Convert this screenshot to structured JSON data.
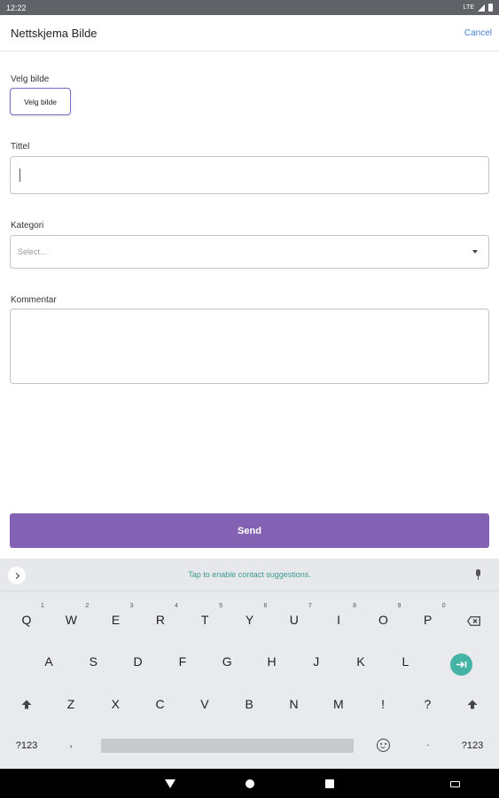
{
  "status_bar": {
    "time": "12:22",
    "network": "LTE"
  },
  "app_bar": {
    "title": "Nettskjema Bilde",
    "cancel": "Cancel"
  },
  "form": {
    "image_label": "Velg bilde",
    "image_button": "Velg bilde",
    "title_label": "Tittel",
    "title_value": "",
    "category_label": "Kategori",
    "category_placeholder": "Select...",
    "comment_label": "Kommentar",
    "comment_value": "",
    "send_label": "Send"
  },
  "keyboard": {
    "suggestion_text": "Tap to enable contact suggestions.",
    "row1": [
      {
        "label": "Q",
        "hint": "1"
      },
      {
        "label": "W",
        "hint": "2"
      },
      {
        "label": "E",
        "hint": "3"
      },
      {
        "label": "R",
        "hint": "4"
      },
      {
        "label": "T",
        "hint": "5"
      },
      {
        "label": "Y",
        "hint": "6"
      },
      {
        "label": "U",
        "hint": "7"
      },
      {
        "label": "I",
        "hint": "8"
      },
      {
        "label": "O",
        "hint": "9"
      },
      {
        "label": "P",
        "hint": "0"
      }
    ],
    "row2": [
      "A",
      "S",
      "D",
      "F",
      "G",
      "H",
      "J",
      "K",
      "L"
    ],
    "row3": [
      "Z",
      "X",
      "C",
      "V",
      "B",
      "N",
      "M",
      "!",
      "?"
    ],
    "symbols_label": "?123",
    "comma_label": ",",
    "period_label": ".",
    "icons": {
      "enter": "enter-arrow-icon",
      "backspace": "backspace-icon",
      "shift": "shift-icon",
      "emoji": "emoji-icon",
      "mic": "mic-icon"
    },
    "colors": {
      "enter_key": "#45b3a5",
      "suggestion_text": "#3d9b8f"
    }
  },
  "colors": {
    "accent": "#8462b3",
    "link": "#4a80d6",
    "button_border": "#7c6bc7"
  }
}
